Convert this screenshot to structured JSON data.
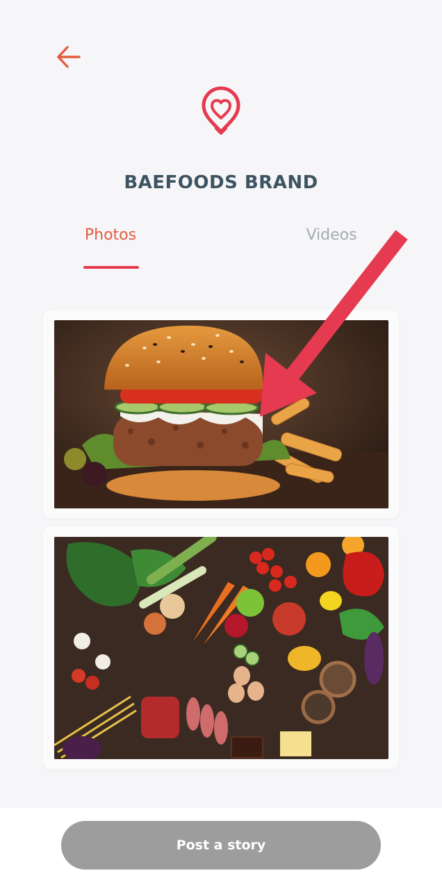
{
  "header": {
    "back_icon": "arrow-left-icon",
    "logo_icon": "heart-location-pin-icon",
    "brand_name": "BAEFOODS BRAND"
  },
  "tabs": [
    {
      "label": "Photos",
      "active": true
    },
    {
      "label": "Videos",
      "active": false
    }
  ],
  "gallery": [
    {
      "subject": "burger-photo"
    },
    {
      "subject": "vegetables-flatlay-photo"
    }
  ],
  "footer": {
    "post_label": "Post a story"
  },
  "annotation": {
    "icon": "pointer-arrow"
  },
  "colors": {
    "accent": "#e55b3c",
    "brand_red": "#e53a4f",
    "title": "#3d5361",
    "inactive_tab": "#a4abb3",
    "button_disabled": "#9d9d9d",
    "background": "#f6f6f8"
  }
}
